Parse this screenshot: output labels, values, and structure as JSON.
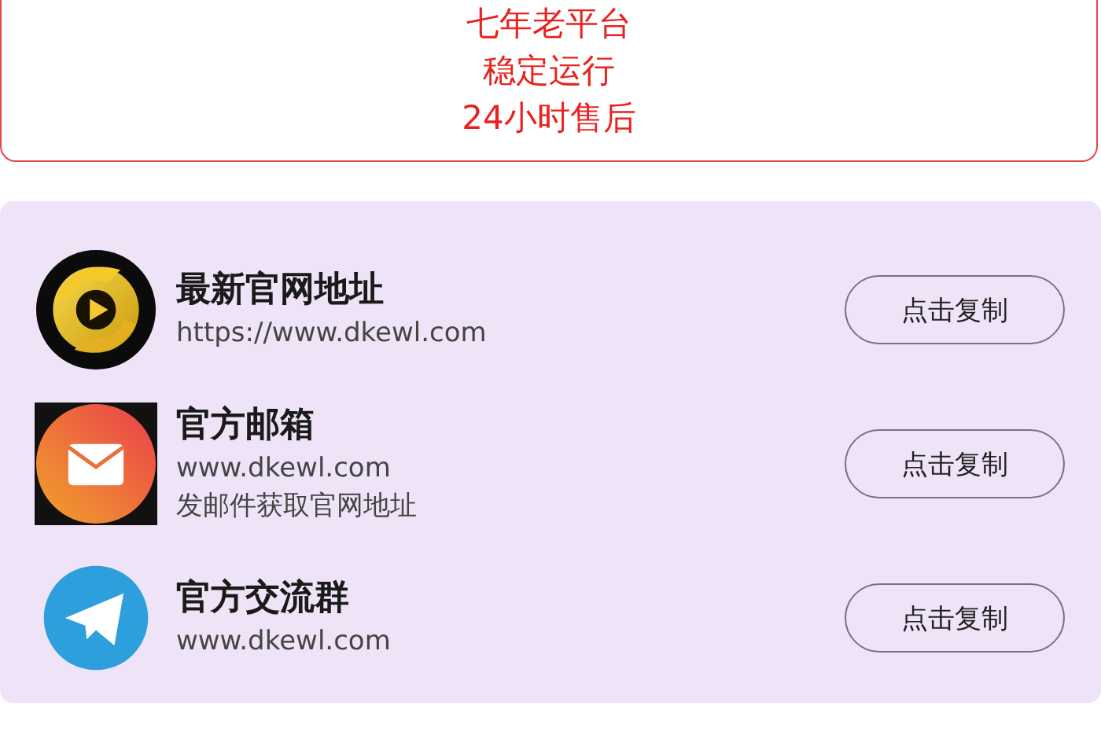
{
  "banner": {
    "lines": [
      "七年老平台",
      "稳定运行",
      "24小时售后"
    ]
  },
  "contacts": [
    {
      "kind": "video",
      "title": "最新官网地址",
      "lines": [
        "https://www.dkewl.com"
      ],
      "button": "点击复制"
    },
    {
      "kind": "mail",
      "title": "官方邮箱",
      "lines": [
        "www.dkewl.com",
        "发邮件获取官网地址"
      ],
      "button": "点击复制"
    },
    {
      "kind": "plane",
      "title": "官方交流群",
      "lines": [
        "www.dkewl.com"
      ],
      "button": "点击复制"
    }
  ]
}
